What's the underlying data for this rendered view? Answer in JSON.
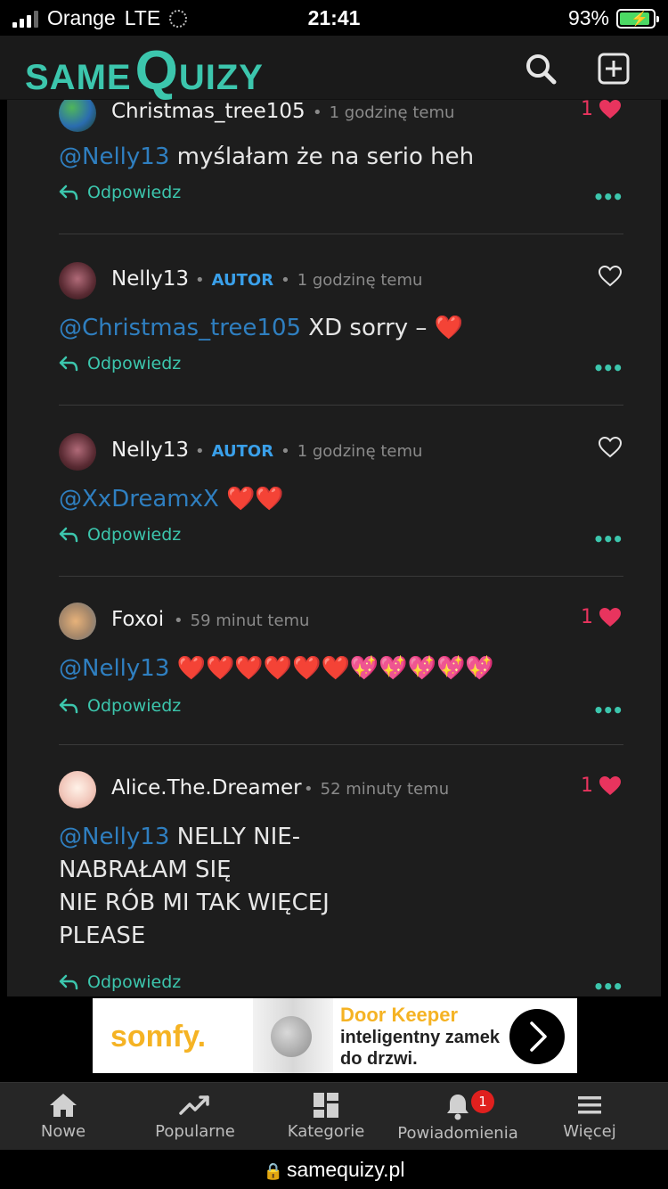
{
  "status_bar": {
    "carrier": "Orange",
    "network": "LTE",
    "time": "21:41",
    "battery": "93%",
    "battery_level": 0.93
  },
  "header": {
    "logo_same": "SAME",
    "logo_q": "Q",
    "logo_uizy": "UIZY",
    "accent_color": "#3cc6ad"
  },
  "comments": [
    {
      "user": "Christmas_tree105",
      "is_author": false,
      "time": "1 godzinę temu",
      "likes": "1",
      "liked": true,
      "mention": "@Nelly13",
      "text": " myślałam że na serio heh",
      "reply": "Odpowiedz",
      "more": "•••"
    },
    {
      "user": "Nelly13",
      "is_author": true,
      "author_label": "AUTOR",
      "time": "1 godzinę temu",
      "likes": "",
      "liked": false,
      "mention": "@Christmas_tree105",
      "text": " XD sorry – ❤️",
      "reply": "Odpowiedz",
      "more": "•••"
    },
    {
      "user": "Nelly13",
      "is_author": true,
      "author_label": "AUTOR",
      "time": "1 godzinę temu",
      "likes": "",
      "liked": false,
      "mention": "@XxDreamxX",
      "text": " ❤️❤️",
      "reply": "Odpowiedz",
      "more": "•••"
    },
    {
      "user": "Foxoi",
      "is_author": false,
      "time": "59 minut temu",
      "likes": "1",
      "liked": true,
      "mention": "@Nelly13",
      "text": " ❤️❤️❤️❤️❤️❤️💖💖💖💖💖",
      "reply": "Odpowiedz",
      "more": "•••"
    },
    {
      "user": "Alice.The.Dreamer",
      "is_author": false,
      "time": "52 minuty temu",
      "likes": "1",
      "liked": true,
      "mention": "@Nelly13",
      "text": " NELLY NIE-\nNABRAŁAM SIĘ\nNIE RÓB MI TAK WIĘCEJ\nPLEASE",
      "reply": "Odpowiedz",
      "more": "•••"
    }
  ],
  "ad": {
    "brand": "somfy.",
    "title": "Door Keeper",
    "subtitle": "inteligentny zamek do drzwi."
  },
  "bottom_nav": [
    {
      "label": "Nowe",
      "icon": "home-icon"
    },
    {
      "label": "Popularne",
      "icon": "trending-icon"
    },
    {
      "label": "Kategorie",
      "icon": "grid-icon"
    },
    {
      "label": "Powiadomienia",
      "icon": "bell-icon",
      "badge": "1"
    },
    {
      "label": "Więcej",
      "icon": "menu-icon"
    }
  ],
  "url_bar": {
    "url": "samequizy.pl"
  }
}
